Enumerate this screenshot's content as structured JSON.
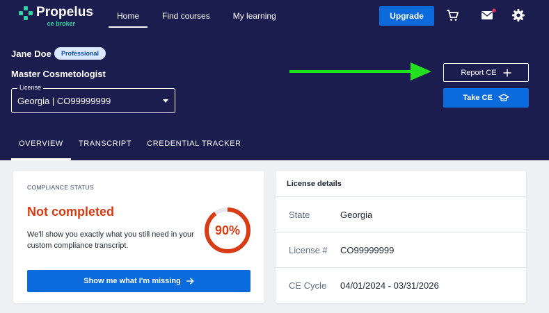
{
  "brand": {
    "name": "Propelus",
    "sub": "ce broker",
    "accent": "#2ed3a0"
  },
  "nav": {
    "items": [
      "Home",
      "Find courses",
      "My learning"
    ]
  },
  "header_actions": {
    "upgrade": "Upgrade"
  },
  "profile": {
    "name": "Jane Doe",
    "badge": "Professional",
    "profession": "Master Cosmetologist",
    "license_label": "License",
    "license_value": "Georgia | CO99999999"
  },
  "actions": {
    "report": "Report CE",
    "take": "Take CE"
  },
  "tabs": [
    "OVERVIEW",
    "TRANSCRIPT",
    "CREDENTIAL TRACKER"
  ],
  "compliance": {
    "label": "COMPLIANCE STATUS",
    "status": "Not completed",
    "description": "We'll show you exactly what you still need in your custom compliance transcript.",
    "percent": "90%",
    "percent_value": 0.9,
    "button": "Show me what I'm missing",
    "status_color": "#d93b14"
  },
  "license_details": {
    "title": "License details",
    "rows": [
      {
        "key": "State",
        "value": "Georgia"
      },
      {
        "key": "License #",
        "value": "CO99999999"
      },
      {
        "key": "CE Cycle",
        "value": "04/01/2024 - 03/31/2026"
      }
    ]
  },
  "colors": {
    "header_bg": "#1b1d4e",
    "primary": "#0c6bdc",
    "annotation_arrow": "#22e01f"
  }
}
